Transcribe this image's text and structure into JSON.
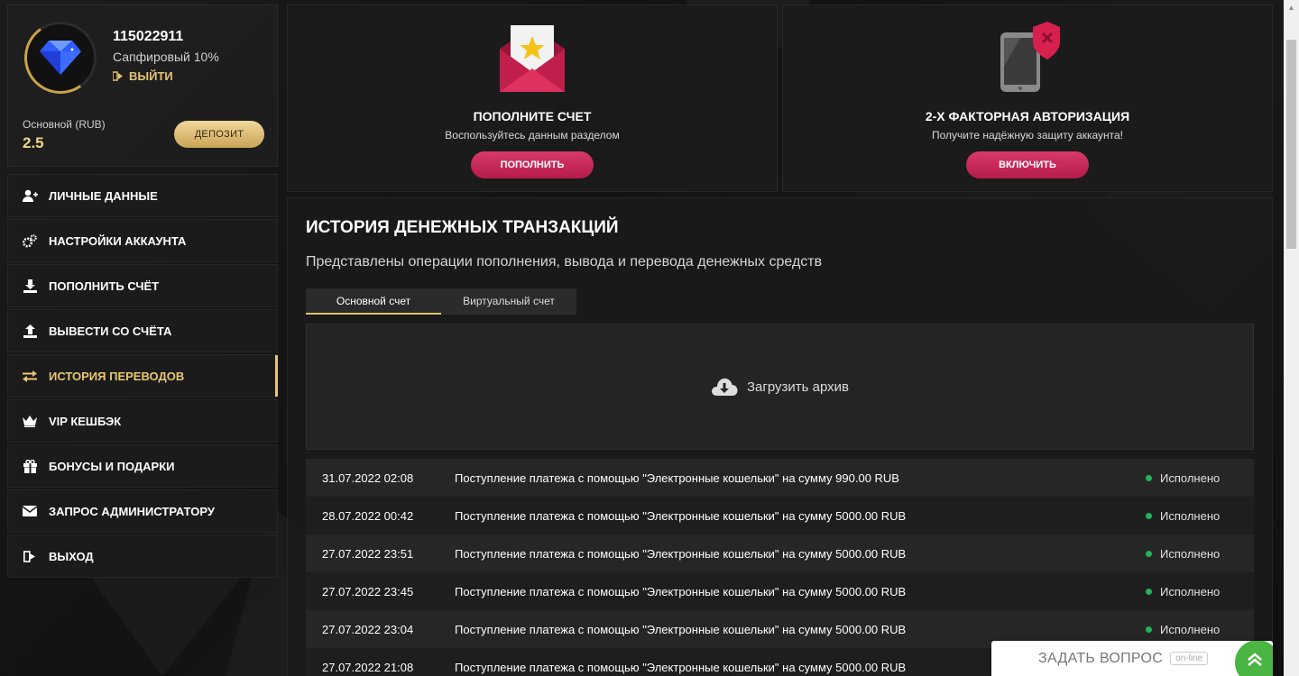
{
  "profile": {
    "user_id": "115022911",
    "level": "Сапфировый 10%",
    "logout_label": "ВЫЙТИ",
    "balance_label": "Основной (RUB)",
    "balance_value": "2.5",
    "deposit_label": "ДЕПОЗИТ",
    "avatar_icon": "diamond-icon",
    "accent_color": "#e8c774"
  },
  "menu": {
    "items": [
      {
        "label": "ЛИЧНЫЕ ДАННЫЕ",
        "icon": "user-plus-icon"
      },
      {
        "label": "НАСТРОЙКИ АККАУНТА",
        "icon": "gears-icon"
      },
      {
        "label": "ПОПОЛНИТЬ СЧЁТ",
        "icon": "download-icon"
      },
      {
        "label": "ВЫВЕСТИ СО СЧЁТА",
        "icon": "upload-icon"
      },
      {
        "label": "ИСТОРИЯ ПЕРЕВОДОВ",
        "icon": "transfer-arrows-icon",
        "active": true
      },
      {
        "label": "VIP КЕШБЭК",
        "icon": "crown-icon"
      },
      {
        "label": "БОНУСЫ И ПОДАРКИ",
        "icon": "gift-icon"
      },
      {
        "label": "ЗАПРОС АДМИНИСТРАТОРУ",
        "icon": "envelope-icon"
      },
      {
        "label": "ВЫХОД",
        "icon": "sign-out-icon"
      }
    ]
  },
  "cards": {
    "deposit": {
      "title": "ПОПОЛНИТЕ СЧЕТ",
      "subtitle": "Воспользуйтесь данным разделом",
      "button": "ПОПОЛНИТЬ",
      "icon": "envelope-star-icon"
    },
    "twofa": {
      "title": "2-Х ФАКТОРНАЯ АВТОРИЗАЦИЯ",
      "subtitle": "Получите надёжную защиту аккаунта!",
      "button": "ВКЛЮЧИТЬ",
      "icon": "phone-shield-icon"
    },
    "button_color": "#c8245a"
  },
  "history": {
    "title": "ИСТОРИЯ ДЕНЕЖНЫХ ТРАНЗАКЦИЙ",
    "subtitle": "Представлены операции пополнения, вывода и перевода денежных средств",
    "tabs": [
      {
        "label": "Основной счет",
        "active": true
      },
      {
        "label": "Виртуальный счет",
        "active": false
      }
    ],
    "archive_label": "Загрузить архив",
    "rows": [
      {
        "date": "31.07.2022 02:08",
        "desc": "Поступление платежа с помощью \"Электронные кошельки\" на сумму 990.00 RUB",
        "status": "Исполнено"
      },
      {
        "date": "28.07.2022 00:42",
        "desc": "Поступление платежа с помощью \"Электронные кошельки\" на сумму 5000.00 RUB",
        "status": "Исполнено"
      },
      {
        "date": "27.07.2022 23:51",
        "desc": "Поступление платежа с помощью \"Электронные кошельки\" на сумму 5000.00 RUB",
        "status": "Исполнено"
      },
      {
        "date": "27.07.2022 23:45",
        "desc": "Поступление платежа с помощью \"Электронные кошельки\" на сумму 5000.00 RUB",
        "status": "Исполнено"
      },
      {
        "date": "27.07.2022 23:04",
        "desc": "Поступление платежа с помощью \"Электронные кошельки\" на сумму 5000.00 RUB",
        "status": "Исполнено"
      },
      {
        "date": "27.07.2022 21:08",
        "desc": "Поступление платежа с помощью \"Электронные кошельки\" на сумму 5000.00 RUB",
        "status": ""
      }
    ],
    "status_color": "#21b25a"
  },
  "chat": {
    "label": "ЗАДАТЬ ВОПРОС",
    "status": "on-line",
    "icon": "chevrons-up-icon"
  }
}
